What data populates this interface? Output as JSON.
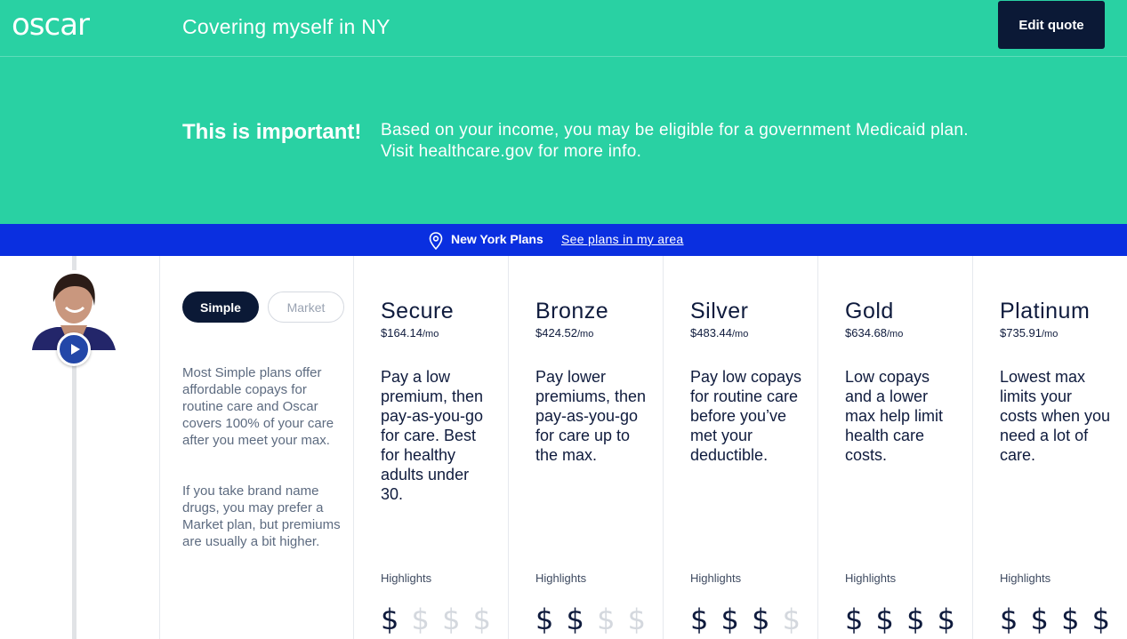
{
  "brand": {
    "logo": "oscar",
    "accent": "#29d1a3",
    "dark": "#0b1936",
    "location_bar": "#0a2fe0"
  },
  "header": {
    "title": "Covering myself in NY",
    "edit_label": "Edit quote"
  },
  "alert": {
    "title": "This is important!",
    "text": "Based on your income, you may be eligible for a government Medicaid plan. Visit healthcare.gov for more info."
  },
  "location": {
    "icon": "map-pin-icon",
    "label": "New York Plans",
    "link": "See plans in my area"
  },
  "video": {
    "icon": "play-icon"
  },
  "toggle": {
    "simple": "Simple",
    "market": "Market",
    "selected": "Simple"
  },
  "description": {
    "p1": "Most Simple plans offer affordable copays for routine care and Oscar covers 100% of your care after you meet your max.",
    "p2": "If you take brand name drugs, you may prefer a Market plan, but premiums are usually a bit higher."
  },
  "plans": [
    {
      "name": "Secure",
      "price": "$164.14",
      "unit": "/mo",
      "desc": "Pay a low premium, then pay-as-you-go for care. Best for healthy adults under 30.",
      "highlights": "Highlights",
      "cost_level": 1
    },
    {
      "name": "Bronze",
      "price": "$424.52",
      "unit": "/mo",
      "desc": "Pay lower premiums, then pay-as-you-go for care up to the max.",
      "highlights": "Highlights",
      "cost_level": 2
    },
    {
      "name": "Silver",
      "price": "$483.44",
      "unit": "/mo",
      "desc": "Pay low copays for routine care before you’ve met your deductible.",
      "highlights": "Highlights",
      "cost_level": 3
    },
    {
      "name": "Gold",
      "price": "$634.68",
      "unit": "/mo",
      "desc": "Low copays and a lower max help limit health care costs.",
      "highlights": "Highlights",
      "cost_level": 4
    },
    {
      "name": "Platinum",
      "price": "$735.91",
      "unit": "/mo",
      "desc": "Lowest max limits your costs when you need a lot of care.",
      "highlights": "Highlights",
      "cost_level": 4
    }
  ]
}
